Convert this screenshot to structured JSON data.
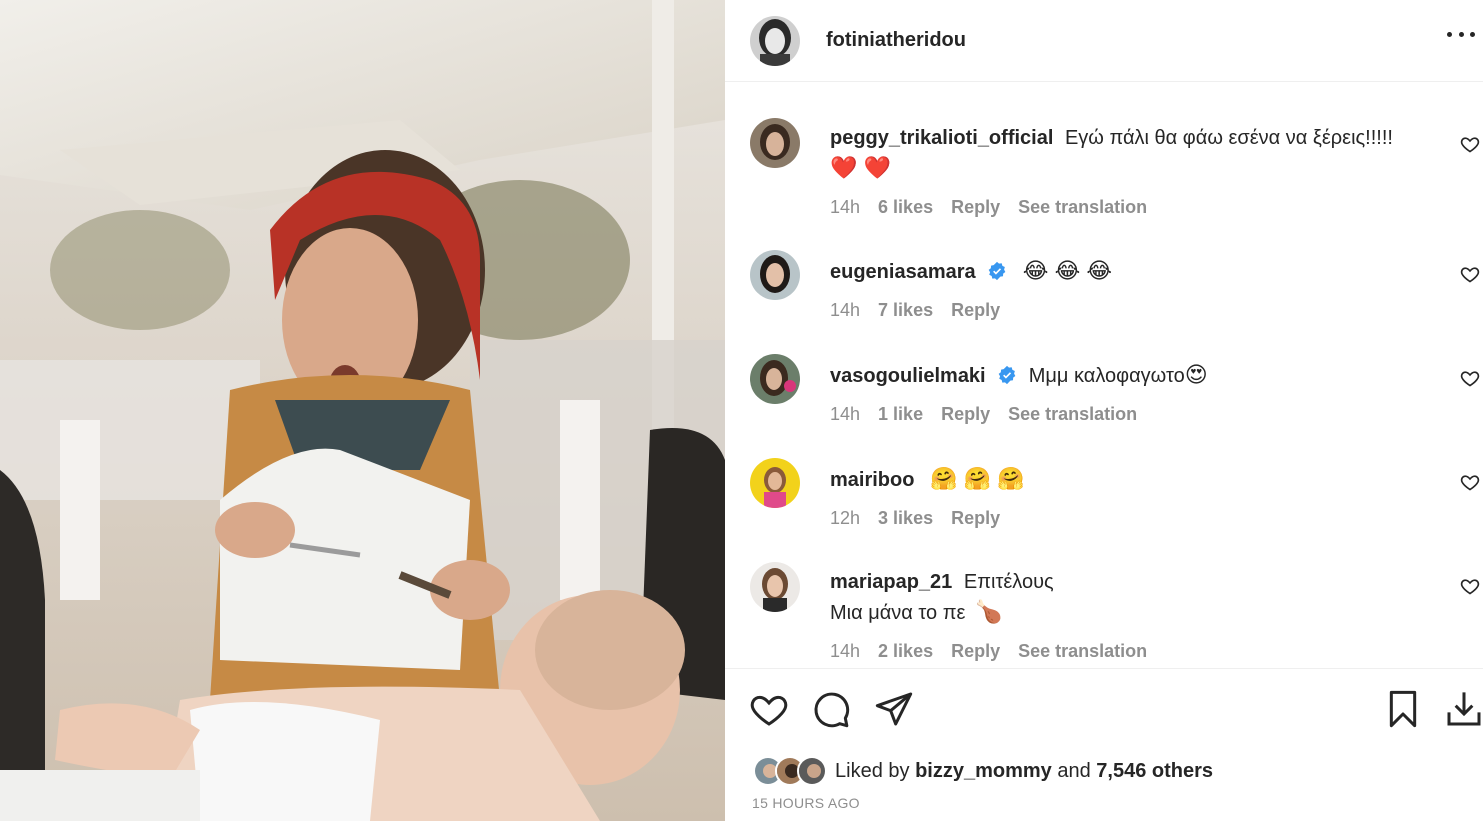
{
  "post": {
    "author": "fotiniatheridou",
    "liked_by_label": "Liked by",
    "liked_by_user": "bizzy_mommy",
    "liked_and": "and",
    "liked_others": "7,546 others",
    "timestamp": "15 HOURS AGO"
  },
  "comments": [
    {
      "user": "peggy_trikalioti_official",
      "verified": false,
      "text": "Εγώ πάλι θα φάω εσένα να ξέρεις!!!!!",
      "emoji": "❤️ ❤️",
      "time": "14h",
      "likes": "6 likes",
      "reply": "Reply",
      "translation": "See translation"
    },
    {
      "user": "eugeniasamara",
      "verified": true,
      "text": "",
      "emoji": "😂 😂 😂",
      "time": "14h",
      "likes": "7 likes",
      "reply": "Reply",
      "translation": ""
    },
    {
      "user": "vasogoulielmaki",
      "verified": true,
      "text": "Μμμ καλοφαγωτο",
      "emoji": "😍",
      "time": "14h",
      "likes": "1 like",
      "reply": "Reply",
      "translation": "See translation"
    },
    {
      "user": "mairiboo",
      "verified": false,
      "text": "",
      "emoji": "🤗 🤗 🤗",
      "time": "12h",
      "likes": "3 likes",
      "reply": "Reply",
      "translation": ""
    },
    {
      "user": "mariapap_21",
      "verified": false,
      "text": "Επιτέλους",
      "line2": "Μια μάνα το πε",
      "emoji": "🍗",
      "time": "14h",
      "likes": "2 likes",
      "reply": "Reply",
      "translation": "See translation"
    }
  ],
  "colors": {
    "text": "#262626",
    "secondary": "#8e8e8e",
    "verified": "#3897f0",
    "divider": "#efefef"
  },
  "icons": [
    "more-icon",
    "heart-icon",
    "comment-icon",
    "share-icon",
    "bookmark-icon",
    "download-icon",
    "verified-badge-icon"
  ]
}
